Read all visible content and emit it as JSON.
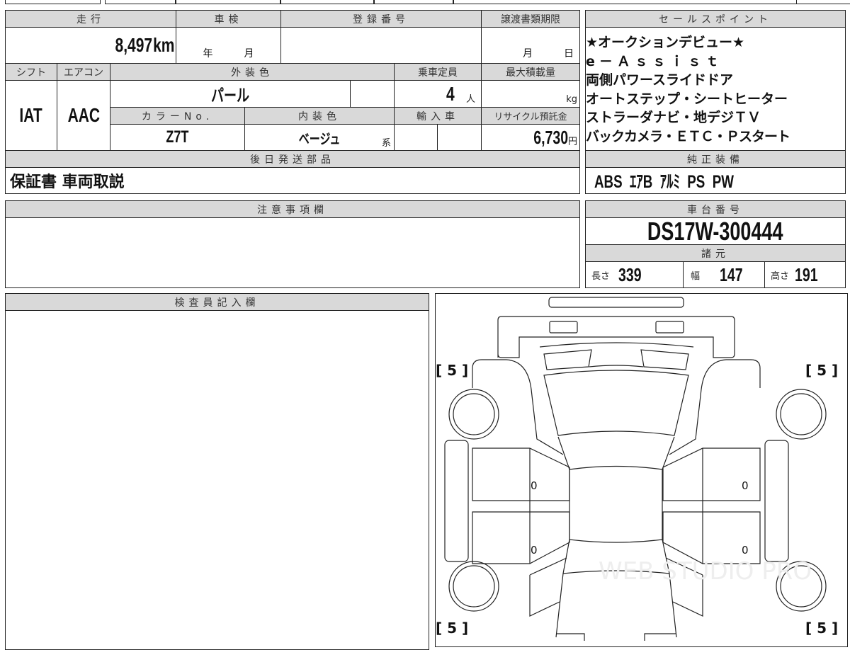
{
  "vehicle": {
    "mileage_label": "走行",
    "mileage": "8,497",
    "mileage_unit": "km",
    "inspection_label": "車検",
    "inspection_year": "年",
    "inspection_month": "月",
    "registration_label": "登録番号",
    "transfer_deadline_label": "譲渡書類期限",
    "transfer_month": "月",
    "transfer_day": "日",
    "shift_label": "シフト",
    "shift": "IAT",
    "ac_label": "エアコン",
    "ac": "AAC",
    "exterior_color_label": "外装色",
    "exterior_color": "パール",
    "capacity_label": "乗車定員",
    "capacity": "4",
    "capacity_unit": "人",
    "max_load_label": "最大積載量",
    "max_load_unit": "kg",
    "color_no_label": "カラーNo.",
    "color_no": "Z7T",
    "interior_color_label": "内装色",
    "interior_color": "ベージュ",
    "interior_suffix": "系",
    "import_label": "輸入車",
    "recycle_label": "リサイクル預託金",
    "recycle_fee": "6,730",
    "recycle_unit": "円",
    "later_parts_label": "後日発送部品",
    "later_parts": "保証書 車両取説"
  },
  "sales_points": {
    "label": "セールスポイント",
    "lines": [
      "★オークションデビュー★",
      "e－Ａｓｓｉｓｔ",
      "両側パワースライドドア",
      "オートステップ・シートヒーター",
      "ストラーダナビ・地デジＴＶ",
      "バックカメラ・ＥＴＣ・Ｐスタート"
    ]
  },
  "equipment": {
    "label": "純正装備",
    "value": "ABS  ｴｱB  ｱﾙﾐ  PS  PW"
  },
  "notes": {
    "label": "注意事項欄"
  },
  "chassis": {
    "label": "車台番号",
    "value": "DS17W-300444"
  },
  "specs": {
    "label": "諸元",
    "length_label": "長さ",
    "length": "339",
    "width_label": "幅",
    "width": "147",
    "height_label": "高さ",
    "height": "191"
  },
  "inspector": {
    "label": "検査員記入欄"
  },
  "diagram": {
    "corner_marks": [
      "[ 5 ]",
      "[ 5 ]",
      "[ 5 ]",
      "[ 5 ]"
    ],
    "door_marks": [
      "0",
      "0",
      "0",
      "0"
    ],
    "watermark": "WEB STUDIO PRO"
  }
}
